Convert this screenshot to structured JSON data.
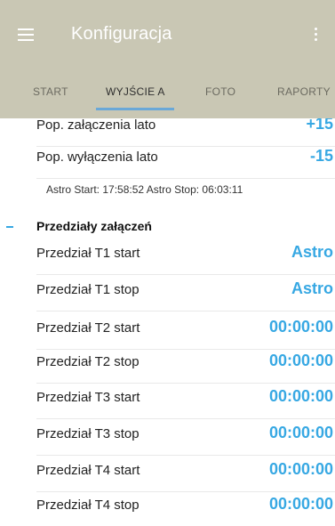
{
  "appbar": {
    "title": "Konfiguracja",
    "menu_icon": "hamburger-menu-icon",
    "more_icon": "more-vertical-icon",
    "background": "#c9c7b4"
  },
  "tabs": [
    {
      "label": "START",
      "active": false
    },
    {
      "label": "WYJŚCIE A",
      "active": true
    },
    {
      "label": "FOTO",
      "active": false
    },
    {
      "label": "RAPORTY",
      "active": false
    }
  ],
  "accent_color": "#37a8e3",
  "rows_top": [
    {
      "label": "Pop. załączenia lato",
      "value": "+15"
    },
    {
      "label": "Pop. wyłączenia lato",
      "value": "-15"
    }
  ],
  "astro_info": "Astro Start: 17:58:52  Astro Stop: 06:03:11",
  "section": {
    "title": "Przedziały załączeń",
    "marker": "collapse-dash-icon"
  },
  "rows": [
    {
      "label": "Przedział T1 start",
      "value": "Astro"
    },
    {
      "label": "Przedział T1 stop",
      "value": "Astro"
    },
    {
      "label": "Przedział T2 start",
      "value": "00:00:00"
    },
    {
      "label": "Przedział T2 stop",
      "value": "00:00:00"
    },
    {
      "label": "Przedział T3 start",
      "value": "00:00:00"
    },
    {
      "label": "Przedział T3 stop",
      "value": "00:00:00"
    },
    {
      "label": "Przedział T4 start",
      "value": "00:00:00"
    },
    {
      "label": "Przedział T4 stop",
      "value": "00:00:00"
    }
  ]
}
